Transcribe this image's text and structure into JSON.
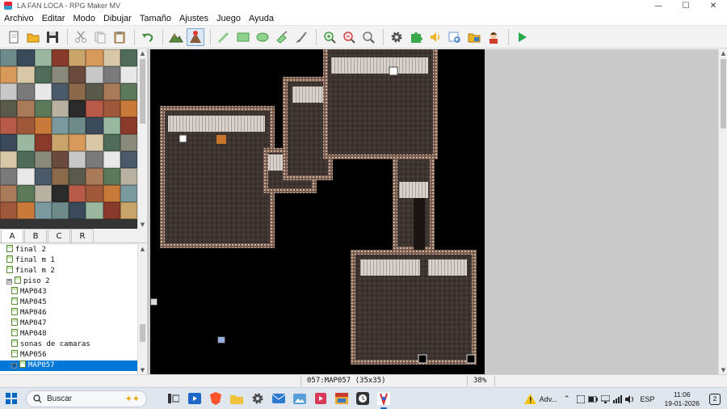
{
  "window": {
    "title": "LA FAN LOCA - RPG Maker MV",
    "controls": {
      "minimize": "—",
      "maximize": "☐",
      "close": "✕"
    }
  },
  "menu": [
    "Archivo",
    "Editar",
    "Modo",
    "Dibujar",
    "Tamaño",
    "Ajustes",
    "Juego",
    "Ayuda"
  ],
  "toolbar": {
    "buttons": [
      "new-project",
      "open-project",
      "save-project",
      "cut",
      "copy",
      "paste",
      "undo",
      "map-mode",
      "event-mode",
      "pencil",
      "rectangle",
      "ellipse",
      "flood-fill",
      "shadow-pen",
      "zoom-in",
      "zoom-out",
      "zoom-actual",
      "database",
      "plugin-manager",
      "sound-test",
      "event-searcher",
      "resource-manager",
      "character-generator",
      "playtest"
    ],
    "active_button": "event-mode"
  },
  "tileset_tabs": [
    "A",
    "B",
    "C",
    "R"
  ],
  "selected_tileset_tab": "A",
  "map_tree": [
    {
      "label": "final 2",
      "level": 1,
      "type": "map"
    },
    {
      "label": "final m 1",
      "level": 1,
      "type": "map"
    },
    {
      "label": "final m 2",
      "level": 1,
      "type": "map"
    },
    {
      "label": "piso 2",
      "level": 1,
      "type": "folder",
      "expander": "⊟"
    },
    {
      "label": "MAP043",
      "level": 2,
      "type": "map"
    },
    {
      "label": "MAP045",
      "level": 2,
      "type": "map"
    },
    {
      "label": "MAP046",
      "level": 2,
      "type": "map"
    },
    {
      "label": "MAP047",
      "level": 2,
      "type": "map"
    },
    {
      "label": "MAP048",
      "level": 2,
      "type": "map"
    },
    {
      "label": "sonas de camaras",
      "level": 2,
      "type": "map"
    },
    {
      "label": "MAP056",
      "level": 2,
      "type": "map"
    },
    {
      "label": "MAP057",
      "level": 2,
      "type": "map",
      "selected": true,
      "expander": "⊟"
    }
  ],
  "status": {
    "map": "057:MAP057 (35x35)",
    "zoom": "38%"
  },
  "taskbar": {
    "search_placeholder": "Buscar",
    "apps": [
      "task-view",
      "media-player",
      "brave-browser",
      "file-explorer",
      "settings",
      "mail",
      "photos",
      "media",
      "rpg-maker-mv",
      "clock-app",
      "rpg-maker-active"
    ],
    "tray_alert": "Adv...",
    "language": "ESP",
    "time": "11:06",
    "date": "19-01-2026",
    "notifications": "2"
  },
  "colors": {
    "map_background": "#000000",
    "floor": "#3d3431",
    "wall_border": "#8a6b5a",
    "wall_top": "#d9d2cc",
    "selection": "#0078d7"
  }
}
